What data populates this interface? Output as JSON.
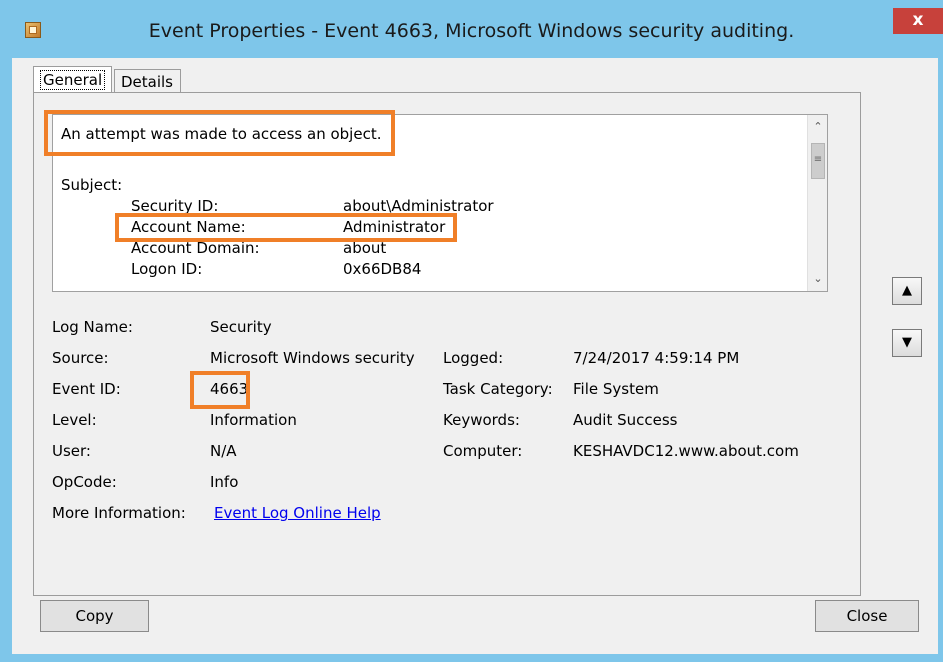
{
  "window": {
    "title": "Event Properties - Event 4663, Microsoft Windows security auditing.",
    "close_label": "x"
  },
  "tabs": [
    {
      "label": "General",
      "selected": true
    },
    {
      "label": "Details",
      "selected": false
    }
  ],
  "description": {
    "headline": "An attempt was made to access an object.",
    "subject_label": "Subject:",
    "fields": [
      {
        "label": "Security ID:",
        "value": "about\\Administrator"
      },
      {
        "label": "Account Name:",
        "value": "Administrator"
      },
      {
        "label": "Account Domain:",
        "value": "about"
      },
      {
        "label": "Logon ID:",
        "value": "0x66DB84"
      }
    ]
  },
  "properties": {
    "log_name": {
      "label": "Log Name:",
      "value": "Security"
    },
    "source": {
      "label": "Source:",
      "value": "Microsoft Windows security"
    },
    "logged": {
      "label": "Logged:",
      "value": "7/24/2017 4:59:14 PM"
    },
    "event_id": {
      "label": "Event ID:",
      "value": "4663"
    },
    "task_category": {
      "label": "Task Category:",
      "value": "File System"
    },
    "level": {
      "label": "Level:",
      "value": "Information"
    },
    "keywords": {
      "label": "Keywords:",
      "value": "Audit Success"
    },
    "user": {
      "label": "User:",
      "value": "N/A"
    },
    "computer": {
      "label": "Computer:",
      "value": "KESHAVDC12.www.about.com"
    },
    "opcode": {
      "label": "OpCode:",
      "value": "Info"
    },
    "more_info": {
      "label": "More Information:",
      "link": "Event Log Online Help"
    }
  },
  "buttons": {
    "copy": "Copy",
    "close": "Close"
  },
  "icons": {
    "up": "up-arrow-icon",
    "down": "down-arrow-icon"
  },
  "colors": {
    "highlight": "#f07f28",
    "frame": "#7ec6ea",
    "close_button": "#c7413b",
    "link": "#0000ee"
  }
}
